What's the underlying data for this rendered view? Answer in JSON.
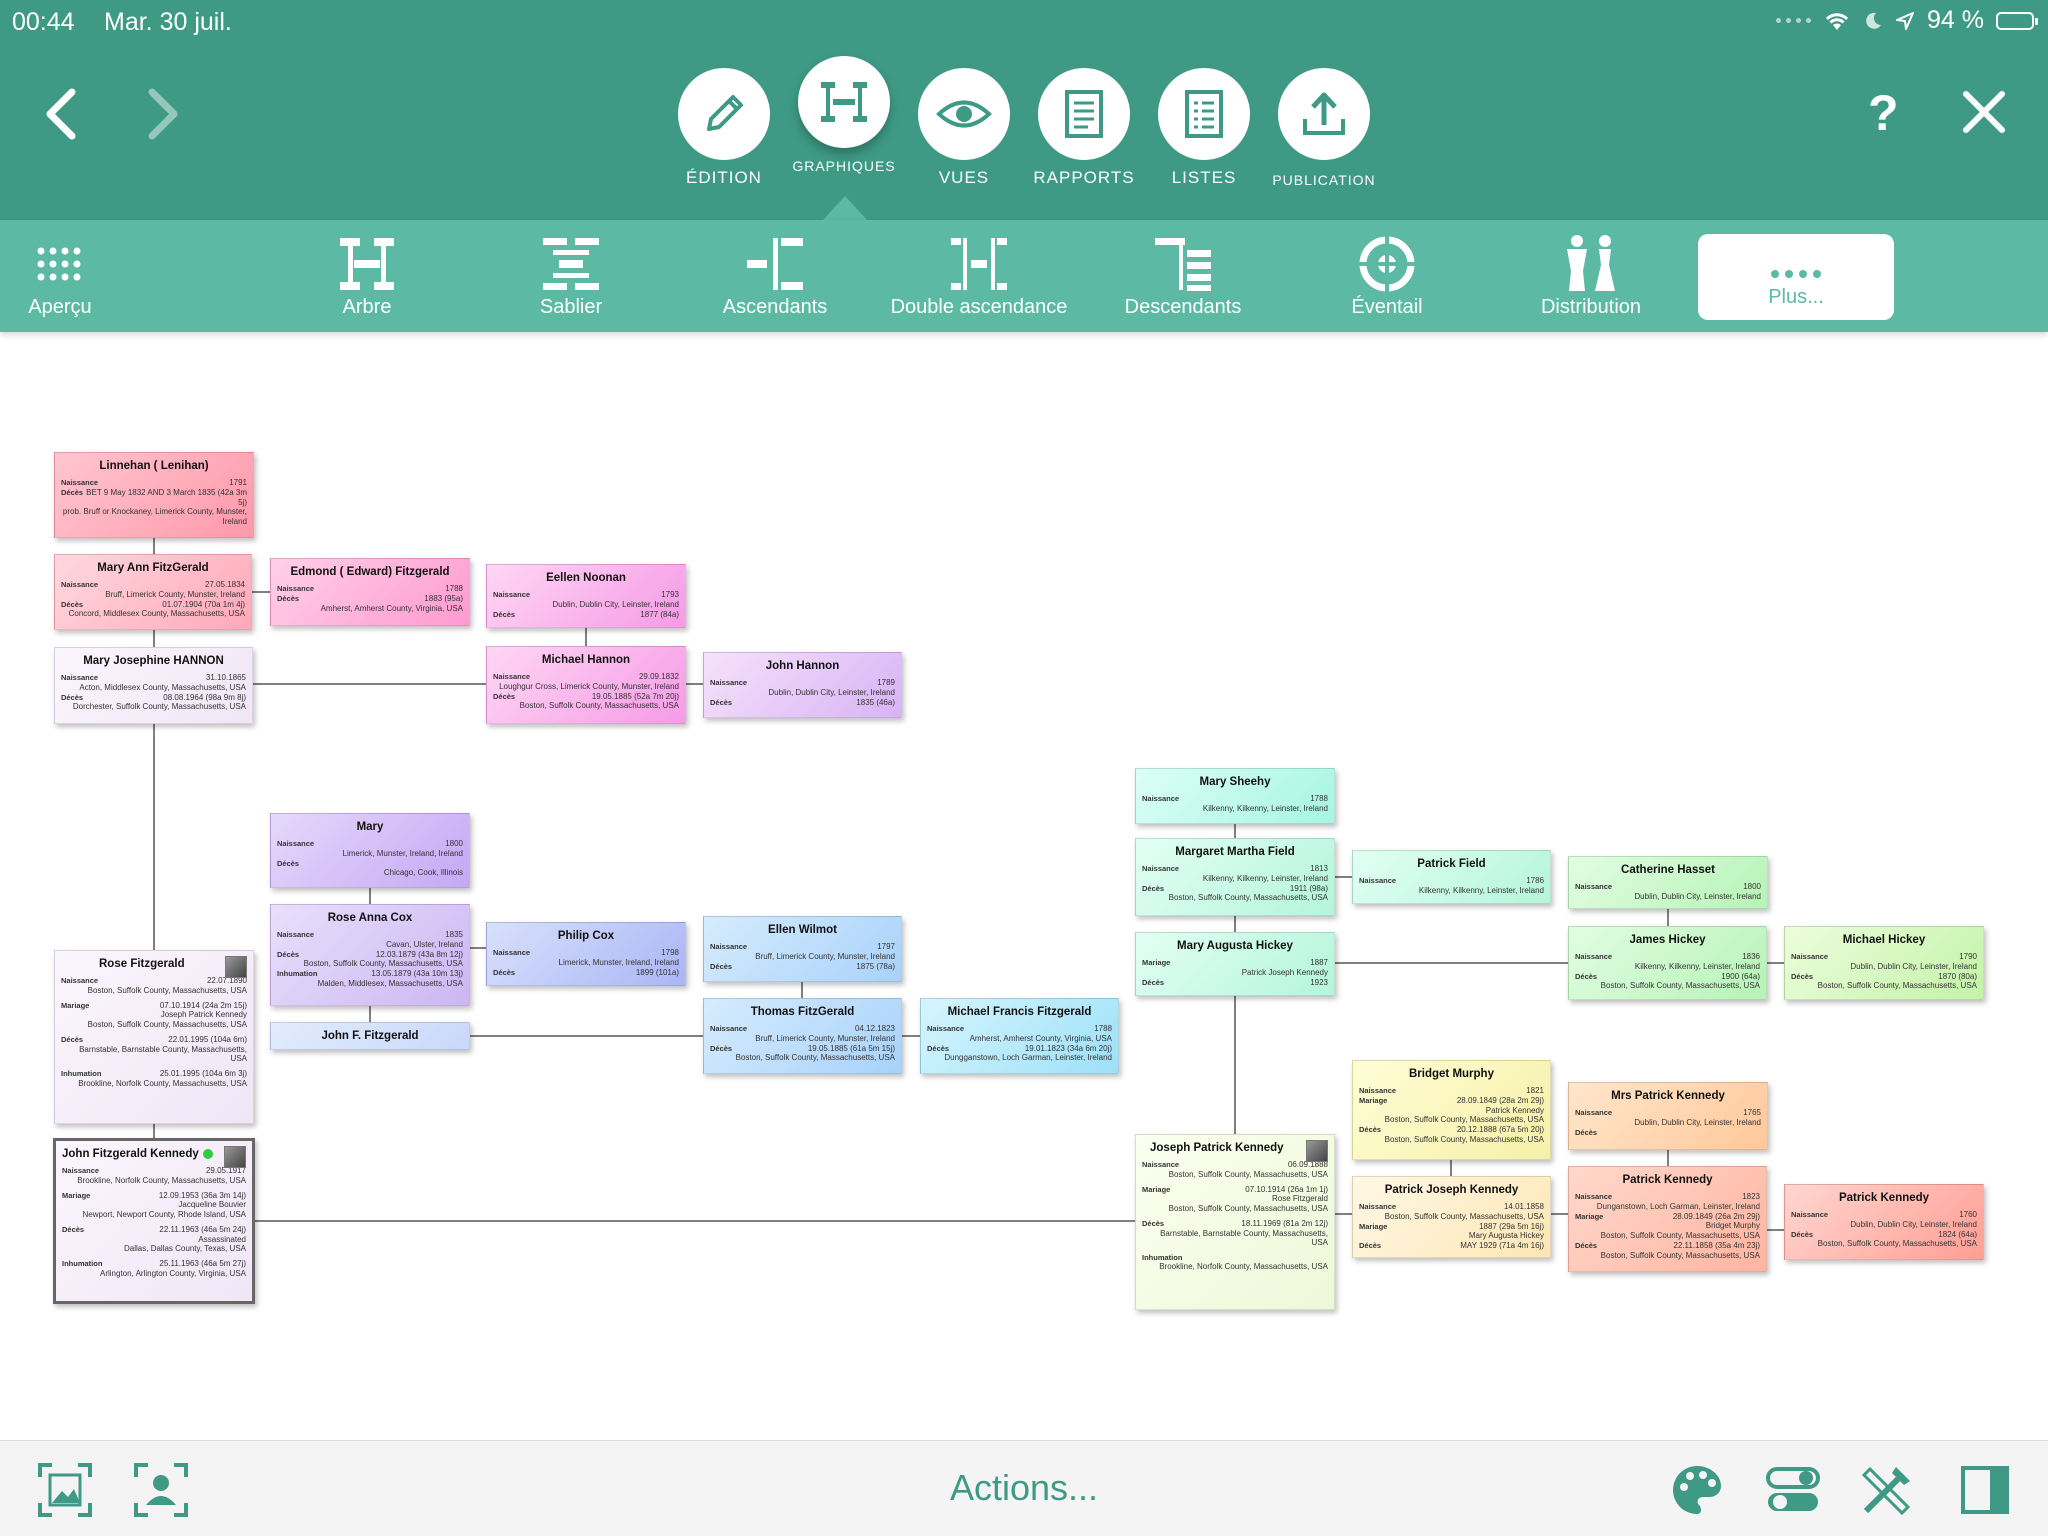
{
  "status": {
    "time": "00:44",
    "date": "Mar. 30 juil.",
    "battery": "94 %"
  },
  "main_tabs": [
    {
      "label": "ÉDITION",
      "icon": "pencil-icon"
    },
    {
      "label": "GRAPHIQUES",
      "icon": "chart-icon",
      "active": true
    },
    {
      "label": "VUES",
      "icon": "eye-icon"
    },
    {
      "label": "RAPPORTS",
      "icon": "report-icon"
    },
    {
      "label": "LISTES",
      "icon": "list-icon"
    },
    {
      "label": "PUBLICATION",
      "icon": "upload-icon"
    }
  ],
  "header": {
    "help": "?"
  },
  "sub_tabs": [
    {
      "label": "Aperçu",
      "icon": "grid-icon"
    },
    {
      "label": "Arbre",
      "icon": "tree-icon"
    },
    {
      "label": "Sablier",
      "icon": "hourglass-icon"
    },
    {
      "label": "Ascendants",
      "icon": "ancestors-icon"
    },
    {
      "label": "Double ascendance",
      "icon": "double-ancestry-icon"
    },
    {
      "label": "Descendants",
      "icon": "descendants-icon"
    },
    {
      "label": "Éventail",
      "icon": "fan-icon"
    },
    {
      "label": "Distribution",
      "icon": "distribution-icon"
    },
    {
      "label": "Plus...",
      "icon": "more-icon",
      "selected": true
    }
  ],
  "persons": [
    {
      "name": "Linnehan ( Lenihan)",
      "rows": [
        [
          "Naissance",
          "1791"
        ],
        [
          "Décès",
          "BET 9 May 1832 AND 3 March 1835 (42a 3m 5j)"
        ]
      ],
      "extra": [
        "prob. Bruff or Knockaney, Limerick County, Munster, Ireland"
      ]
    },
    {
      "name": "Mary Ann FitzGerald",
      "rows": [
        [
          "Naissance",
          "27.05.1834"
        ],
        [
          "",
          "Bruff, Limerick County, Munster, Ireland"
        ],
        [
          "Décès",
          "01.07.1904 (70a 1m 4j)"
        ],
        [
          "",
          "Concord, Middlesex County, Massachusetts, USA"
        ]
      ]
    },
    {
      "name": "Edmond ( Edward) Fitzgerald",
      "rows": [
        [
          "Naissance",
          "1788"
        ],
        [
          "Décès",
          "1883 (95a)"
        ],
        [
          "",
          "Amherst, Amherst County, Virginia, USA"
        ]
      ]
    },
    {
      "name": "Eellen Noonan",
      "rows": [
        [
          "Naissance",
          "1793"
        ],
        [
          "",
          "Dublin, Dublin City, Leinster, Ireland"
        ],
        [
          "Décès",
          "1877 (84a)"
        ]
      ]
    },
    {
      "name": "Mary Josephine HANNON",
      "rows": [
        [
          "Naissance",
          "31.10.1865"
        ],
        [
          "",
          "Acton, Middlesex County, Massachusetts, USA"
        ],
        [
          "Décès",
          "08.08.1964 (98a 9m 8j)"
        ],
        [
          "",
          "Dorchester, Suffolk County, Massachusetts, USA"
        ]
      ]
    },
    {
      "name": "Michael Hannon",
      "rows": [
        [
          "Naissance",
          "29.09.1832"
        ],
        [
          "",
          "Loughgur Cross, Limerick County, Munster, Ireland"
        ],
        [
          "Décès",
          "19.05.1885 (52a 7m 20j)"
        ],
        [
          "",
          "Boston, Suffolk County, Massachusetts, USA"
        ]
      ]
    },
    {
      "name": "John Hannon",
      "rows": [
        [
          "Naissance",
          "1789"
        ],
        [
          "",
          "Dublin, Dublin City, Leinster, Ireland"
        ],
        [
          "Décès",
          "1835 (46a)"
        ]
      ]
    },
    {
      "name": "Mary",
      "rows": [
        [
          "Naissance",
          "1800"
        ],
        [
          "",
          "Limerick, Munster, Ireland, Ireland"
        ],
        [
          "Décès",
          ""
        ],
        [
          "",
          "Chicago, Cook, Illinois"
        ]
      ]
    },
    {
      "name": "Rose Anna Cox",
      "rows": [
        [
          "Naissance",
          "1835"
        ],
        [
          "",
          "Cavan, Ulster, Ireland"
        ],
        [
          "Décès",
          "12.03.1879 (43a 8m 12j)"
        ],
        [
          "",
          "Boston, Suffolk County, Massachusetts, USA"
        ],
        [
          "Inhumation",
          "13.05.1879 (43a 10m 13j)"
        ],
        [
          "",
          "Malden, Middlesex, Massachusetts, USA"
        ]
      ]
    },
    {
      "name": "Philip Cox",
      "rows": [
        [
          "Naissance",
          "1798"
        ],
        [
          "",
          "Limerick, Munster, Ireland, Ireland"
        ],
        [
          "Décès",
          "1899 (101a)"
        ]
      ]
    },
    {
      "name": "John F. Fitzgerald",
      "rows": []
    },
    {
      "name": "Ellen Wilmot",
      "rows": [
        [
          "Naissance",
          "1797"
        ],
        [
          "",
          "Bruff, Limerick County, Munster, Ireland"
        ],
        [
          "Décès",
          "1875 (78a)"
        ]
      ]
    },
    {
      "name": "Thomas FitzGerald",
      "rows": [
        [
          "Naissance",
          "04.12.1823"
        ],
        [
          "",
          "Bruff, Limerick County, Munster, Ireland"
        ],
        [
          "Décès",
          "19.05.1885 (61a 5m 15j)"
        ],
        [
          "",
          "Boston, Suffolk County, Massachusetts, USA"
        ]
      ]
    },
    {
      "name": "Michael Francis Fitzgerald",
      "rows": [
        [
          "Naissance",
          "1788"
        ],
        [
          "",
          "Amherst, Amherst County, Virginia, USA"
        ],
        [
          "Décès",
          "19.01.1823 (34a 6m 20j)"
        ],
        [
          "",
          "Dungganstown, Loch Garman, Leinster, Ireland"
        ]
      ]
    },
    {
      "name": "Rose Fitzgerald",
      "rows": [
        [
          "Naissance",
          "22.07.1890"
        ],
        [
          "",
          "Boston, Suffolk County, Massachusetts, USA"
        ],
        [
          "Mariage",
          "07.10.1914 (24a 2m 15j)"
        ],
        [
          "",
          "Joseph Patrick Kennedy"
        ],
        [
          "",
          "Boston, Suffolk County, Massachusetts, USA"
        ],
        [
          "Décès",
          "22.01.1995 (104a 6m)"
        ],
        [
          "",
          "Barnstable, Barnstable County, Massachusetts, USA"
        ],
        [
          "Inhumation",
          "25.01.1995 (104a 6m 3j)"
        ],
        [
          "",
          "Brookline, Norfolk County, Massachusetts, USA"
        ]
      ]
    },
    {
      "name": "John Fitzgerald Kennedy",
      "rows": [
        [
          "Naissance",
          "29.05.1917"
        ],
        [
          "",
          "Brookline, Norfolk County, Massachusetts, USA"
        ],
        [
          "Mariage",
          "12.09.1953 (36a 3m 14j)"
        ],
        [
          "",
          "Jacqueline Bouvier"
        ],
        [
          "",
          "Newport, Newport County, Rhode Island, USA"
        ],
        [
          "Décès",
          "22.11.1963 (46a 5m 24j)"
        ],
        [
          "",
          "Assassinated"
        ],
        [
          "",
          "Dallas, Dallas County, Texas, USA"
        ],
        [
          "Inhumation",
          "25.11.1963 (46a 5m 27j)"
        ],
        [
          "",
          "Arlington, Arlington County, Virginia, USA"
        ]
      ]
    },
    {
      "name": "Mary Sheehy",
      "rows": [
        [
          "Naissance",
          "1788"
        ],
        [
          "",
          "Kilkenny, Kilkenny, Leinster, Ireland"
        ]
      ]
    },
    {
      "name": "Margaret Martha Field",
      "rows": [
        [
          "Naissance",
          "1813"
        ],
        [
          "",
          "Kilkenny, Kilkenny, Leinster, Ireland"
        ],
        [
          "Décès",
          "1911 (98a)"
        ],
        [
          "",
          "Boston, Suffolk County, Massachusetts, USA"
        ]
      ]
    },
    {
      "name": "Patrick Field",
      "rows": [
        [
          "Naissance",
          "1786"
        ],
        [
          "",
          "Kilkenny, Kilkenny, Leinster, Ireland"
        ]
      ]
    },
    {
      "name": "Catherine Hasset",
      "rows": [
        [
          "Naissance",
          "1800"
        ],
        [
          "",
          "Dublin, Dublin City, Leinster, Ireland"
        ]
      ]
    },
    {
      "name": "Mary Augusta Hickey",
      "rows": [
        [
          "Mariage",
          "1887"
        ],
        [
          "",
          "Patrick Joseph Kennedy"
        ],
        [
          "Décès",
          "1923"
        ]
      ]
    },
    {
      "name": "James Hickey",
      "rows": [
        [
          "Naissance",
          "1836"
        ],
        [
          "",
          "Kilkenny, Kilkenny, Leinster, Ireland"
        ],
        [
          "Décès",
          "1900 (64a)"
        ],
        [
          "",
          "Boston, Suffolk County, Massachusetts, USA"
        ]
      ]
    },
    {
      "name": "Michael Hickey",
      "rows": [
        [
          "Naissance",
          "1790"
        ],
        [
          "",
          "Dublin, Dublin City, Leinster, Ireland"
        ],
        [
          "Décès",
          "1870 (80a)"
        ],
        [
          "",
          "Boston, Suffolk County, Massachusetts, USA"
        ]
      ]
    },
    {
      "name": "Bridget Murphy",
      "rows": [
        [
          "Naissance",
          "1821"
        ],
        [
          "Mariage",
          "28.09.1849 (28a 2m 29j)"
        ],
        [
          "",
          "Patrick Kennedy"
        ],
        [
          "",
          "Boston, Suffolk County, Massachusetts, USA"
        ],
        [
          "Décès",
          "20.12.1888 (67a 5m 20j)"
        ],
        [
          "",
          "Boston, Suffolk County, Massachusetts, USA"
        ]
      ]
    },
    {
      "name": "Mrs Patrick Kennedy",
      "rows": [
        [
          "Naissance",
          "1765"
        ],
        [
          "",
          "Dublin, Dublin City, Leinster, Ireland"
        ],
        [
          "Décès",
          ""
        ]
      ]
    },
    {
      "name": "Joseph Patrick Kennedy",
      "rows": [
        [
          "Naissance",
          "06.09.1888"
        ],
        [
          "",
          "Boston, Suffolk County, Massachusetts, USA"
        ],
        [
          "Mariage",
          "07.10.1914 (26a 1m 1j)"
        ],
        [
          "",
          "Rose Fitzgerald"
        ],
        [
          "",
          "Boston, Suffolk County, Massachusetts, USA"
        ],
        [
          "Décès",
          "18.11.1969 (81a 2m 12j)"
        ],
        [
          "",
          "Barnstable, Barnstable County, Massachusetts, USA"
        ],
        [
          "Inhumation",
          ""
        ],
        [
          "",
          "Brookline, Norfolk County, Massachusetts, USA"
        ]
      ]
    },
    {
      "name": "Patrick Joseph Kennedy",
      "rows": [
        [
          "Naissance",
          "14.01.1858"
        ],
        [
          "",
          "Boston, Suffolk County, Massachusetts, USA"
        ],
        [
          "Mariage",
          "1887 (29a 5m 16j)"
        ],
        [
          "",
          "Mary Augusta Hickey"
        ],
        [
          "Décès",
          "MAY 1929 (71a 4m 16j)"
        ]
      ]
    },
    {
      "name": "Patrick Kennedy",
      "rows": [
        [
          "Naissance",
          "1823"
        ],
        [
          "",
          "Dunganstown, Loch Garman, Leinster, Ireland"
        ],
        [
          "Mariage",
          "28.09.1849 (26a 2m 29j)"
        ],
        [
          "",
          "Bridget Murphy"
        ],
        [
          "",
          "Boston, Suffolk County, Massachusetts, USA"
        ],
        [
          "Décès",
          "22.11.1858 (35a 4m 23j)"
        ],
        [
          "",
          "Boston, Suffolk County, Massachusetts, USA"
        ]
      ]
    },
    {
      "name": "Patrick Kennedy",
      "rows": [
        [
          "Naissance",
          "1760"
        ],
        [
          "",
          "Dublin, Dublin City, Leinster, Ireland"
        ],
        [
          "Décès",
          "1824 (64a)"
        ],
        [
          "",
          "Boston, Suffolk County, Massachusetts, USA"
        ]
      ]
    }
  ],
  "bottom": {
    "actions_label": "Actions..."
  },
  "colors": {
    "header": "#3e9a85",
    "subbar": "#5cb9a3",
    "accent": "#3e9a85"
  }
}
